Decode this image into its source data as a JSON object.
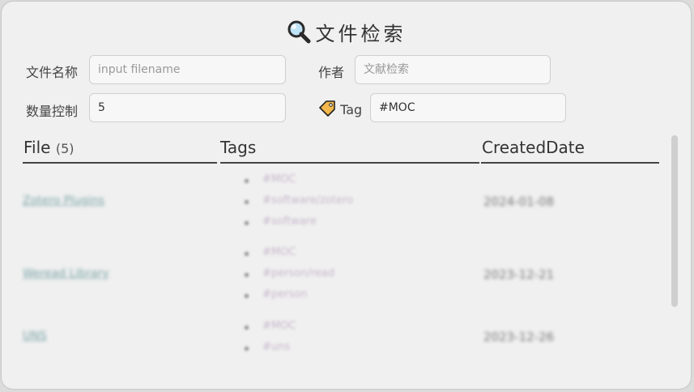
{
  "title": "文件检索",
  "filters": {
    "filename_label": "文件名称",
    "filename_placeholder": "input filename",
    "filename_value": "",
    "author_label": "作者",
    "author_placeholder": "文献检索",
    "author_value": "",
    "count_label": "数量控制",
    "count_value": "5",
    "tag_label": "Tag",
    "tag_value": "#MOC"
  },
  "table": {
    "headers": {
      "file": "File",
      "file_count": "(5)",
      "tags": "Tags",
      "created": "CreatedDate"
    },
    "rows": [
      {
        "file": "Zotero Plugins",
        "tags": [
          "#MOC",
          "#software/zotero",
          "#software"
        ],
        "date": "2024-01-08"
      },
      {
        "file": "Weread Library",
        "tags": [
          "#MOC",
          "#person/read",
          "#person"
        ],
        "date": "2023-12-21"
      },
      {
        "file": "UNS",
        "tags": [
          "#MOC",
          "#uns"
        ],
        "date": "2023-12-26"
      }
    ]
  }
}
